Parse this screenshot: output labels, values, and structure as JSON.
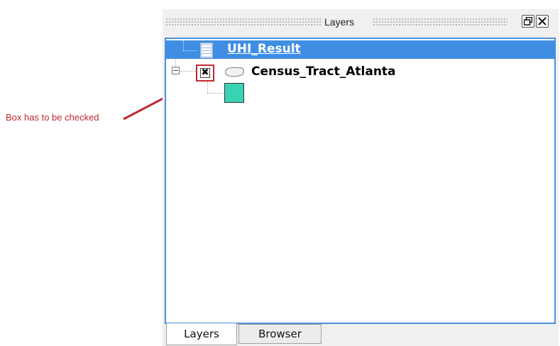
{
  "annotation": {
    "text": "Box has to be checked",
    "color": "#c0292e"
  },
  "panel": {
    "title": "Layers",
    "float_button_icon": "float-window-icon",
    "close_button_icon": "close-icon"
  },
  "layers": [
    {
      "name": "UHI_Result",
      "type_icon": "table-icon",
      "selected": true
    },
    {
      "name": "Census_Tract_Atlanta",
      "type_icon": "polygon-icon",
      "checked": true,
      "checkbox_glyph": "✖",
      "expanded": true,
      "legend_color": "#3ad2b5"
    }
  ],
  "tabs": [
    {
      "label": "Layers",
      "active": true
    },
    {
      "label": "Browser",
      "active": false
    }
  ],
  "colors": {
    "selection": "#3f8ee4",
    "tree_border": "#4a8fdc"
  }
}
